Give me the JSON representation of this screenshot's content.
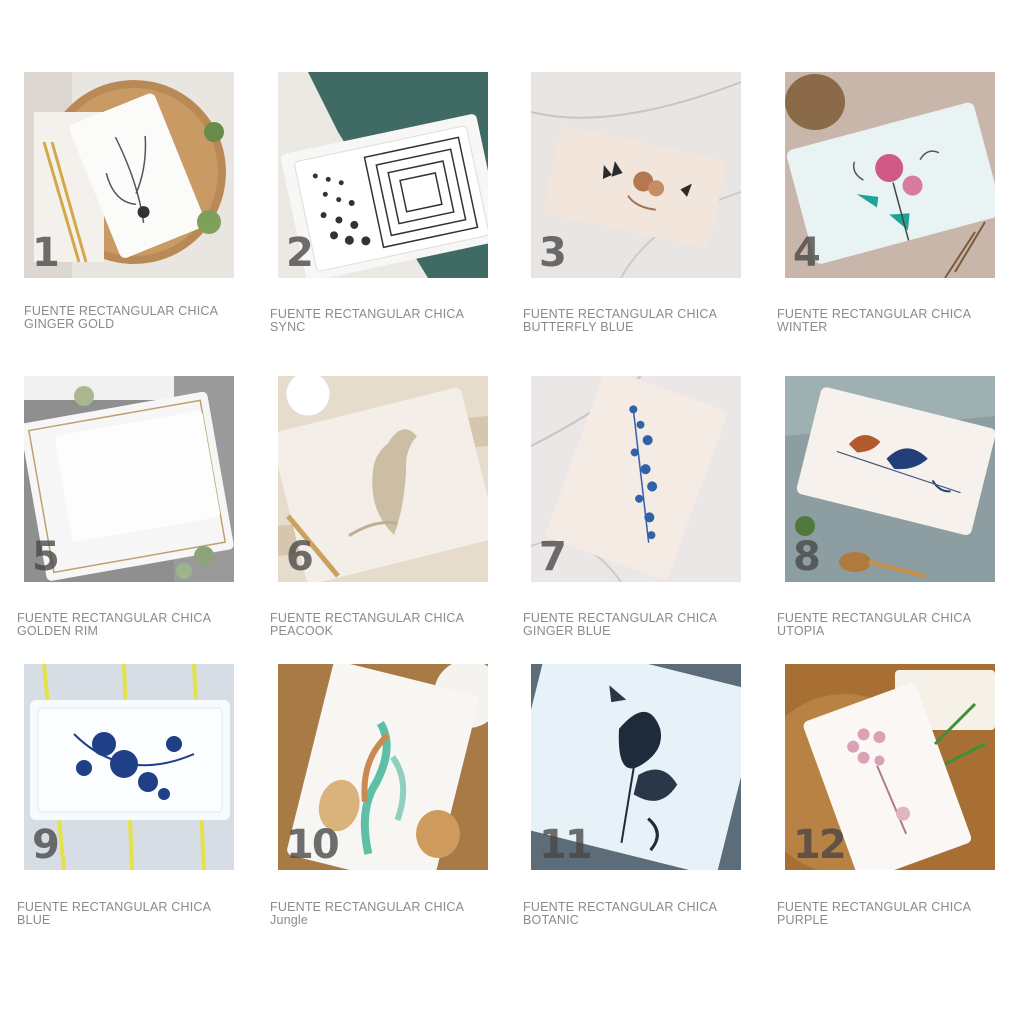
{
  "products": [
    {
      "number": "1",
      "line1": "FUENTE RECTANGULAR CHICA",
      "line2": "GINGER GOLD",
      "photo": "plate-ginger-gold-photo"
    },
    {
      "number": "2",
      "line1": "FUENTE RECTANGULAR CHICA",
      "line2": "SYNC",
      "photo": "plate-sync-photo"
    },
    {
      "number": "3",
      "line1": "FUENTE RECTANGULAR CHICA",
      "line2": "BUTTERFLY BLUE",
      "photo": "plate-butterfly-blue-photo"
    },
    {
      "number": "4",
      "line1": "FUENTE RECTANGULAR CHICA",
      "line2": "WINTER",
      "photo": "plate-winter-photo"
    },
    {
      "number": "5",
      "line1": "FUENTE RECTANGULAR CHICA",
      "line2": "GOLDEN RIM",
      "photo": "plate-golden-rim-photo"
    },
    {
      "number": "6",
      "line1": "FUENTE RECTANGULAR CHICA",
      "line2": "PEACOOK",
      "photo": "plate-peacook-photo"
    },
    {
      "number": "7",
      "line1": "FUENTE RECTANGULAR CHICA",
      "line2": "GINGER BLUE",
      "photo": "plate-ginger-blue-photo"
    },
    {
      "number": "8",
      "line1": "FUENTE RECTANGULAR CHICA",
      "line2": "UTOPIA",
      "photo": "plate-utopia-photo"
    },
    {
      "number": "9",
      "line1": "FUENTE RECTANGULAR CHICA",
      "line2": "BLUE",
      "photo": "plate-blue-photo"
    },
    {
      "number": "10",
      "line1": "FUENTE RECTANGULAR CHICA",
      "line2": "Jungle",
      "photo": "plate-jungle-photo"
    },
    {
      "number": "11",
      "line1": "FUENTE RECTANGULAR CHICA",
      "line2": "BOTANIC",
      "photo": "plate-botanic-photo"
    },
    {
      "number": "12",
      "line1": "FUENTE RECTANGULAR CHICA",
      "line2": "PURPLE",
      "photo": "plate-purple-photo"
    }
  ],
  "colors": {
    "caption": "#8a8a8a",
    "number": "#464646"
  }
}
